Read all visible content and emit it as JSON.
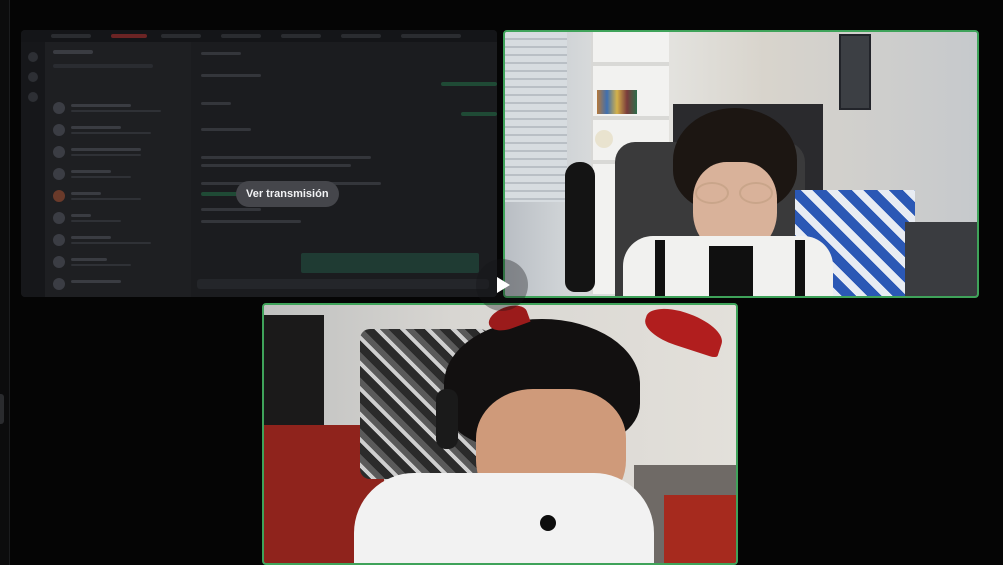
{
  "stream_tile": {
    "watch_stream_label": "Ver transmisión"
  },
  "participants": [
    {
      "tile": "camera-top",
      "speaking": true
    },
    {
      "tile": "camera-bottom",
      "speaking": true
    }
  ],
  "colors": {
    "background": "#050505",
    "speaking_border": "#3fa35a",
    "watch_button_bg": "#45464b"
  },
  "icons": {
    "center_control": "play-icon"
  }
}
